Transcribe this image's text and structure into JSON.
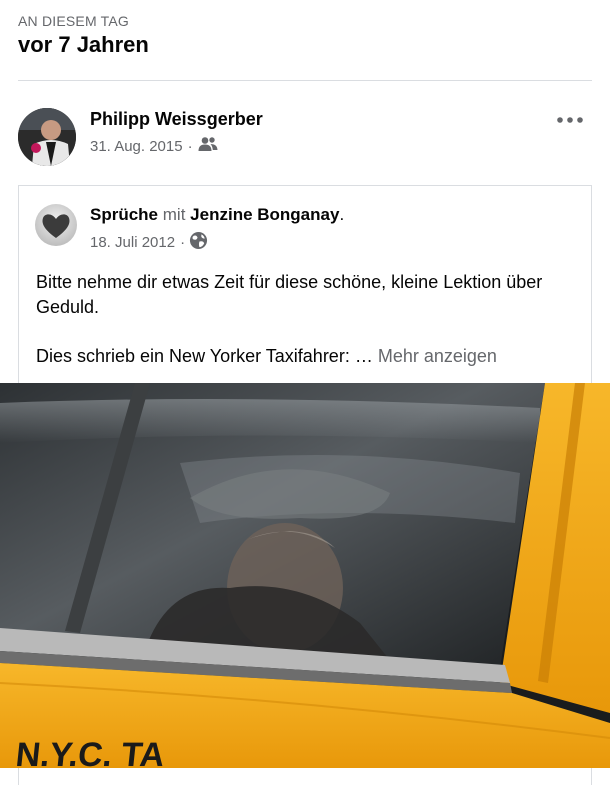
{
  "header": {
    "label": "AN DIESEM TAG",
    "title": "vor 7 Jahren"
  },
  "post": {
    "author": "Philipp Weissgerber",
    "date": "31. Aug. 2015",
    "separator": "·",
    "audience_icon": "friends-icon",
    "menu_icon": "more-options-icon"
  },
  "shared_post": {
    "page_name": "Sprüche",
    "connector": "mit",
    "tagged_name": "Jenzine Bonganay",
    "trailing": ".",
    "date": "18. Juli 2012",
    "separator": "·",
    "audience_icon": "globe-icon",
    "text_line1": "Bitte nehme dir etwas Zeit für diese schöne, kleine Lektion über Geduld.",
    "text_line2": "Dies schrieb ein New Yorker Taxifahrer: …",
    "more_label": "Mehr anzeigen"
  },
  "photo": {
    "taxi_lettering": "N.Y.C. TA"
  },
  "colors": {
    "muted_text": "#65676b",
    "divider": "#dadde1",
    "taxi_yellow": "#f2a90d"
  }
}
